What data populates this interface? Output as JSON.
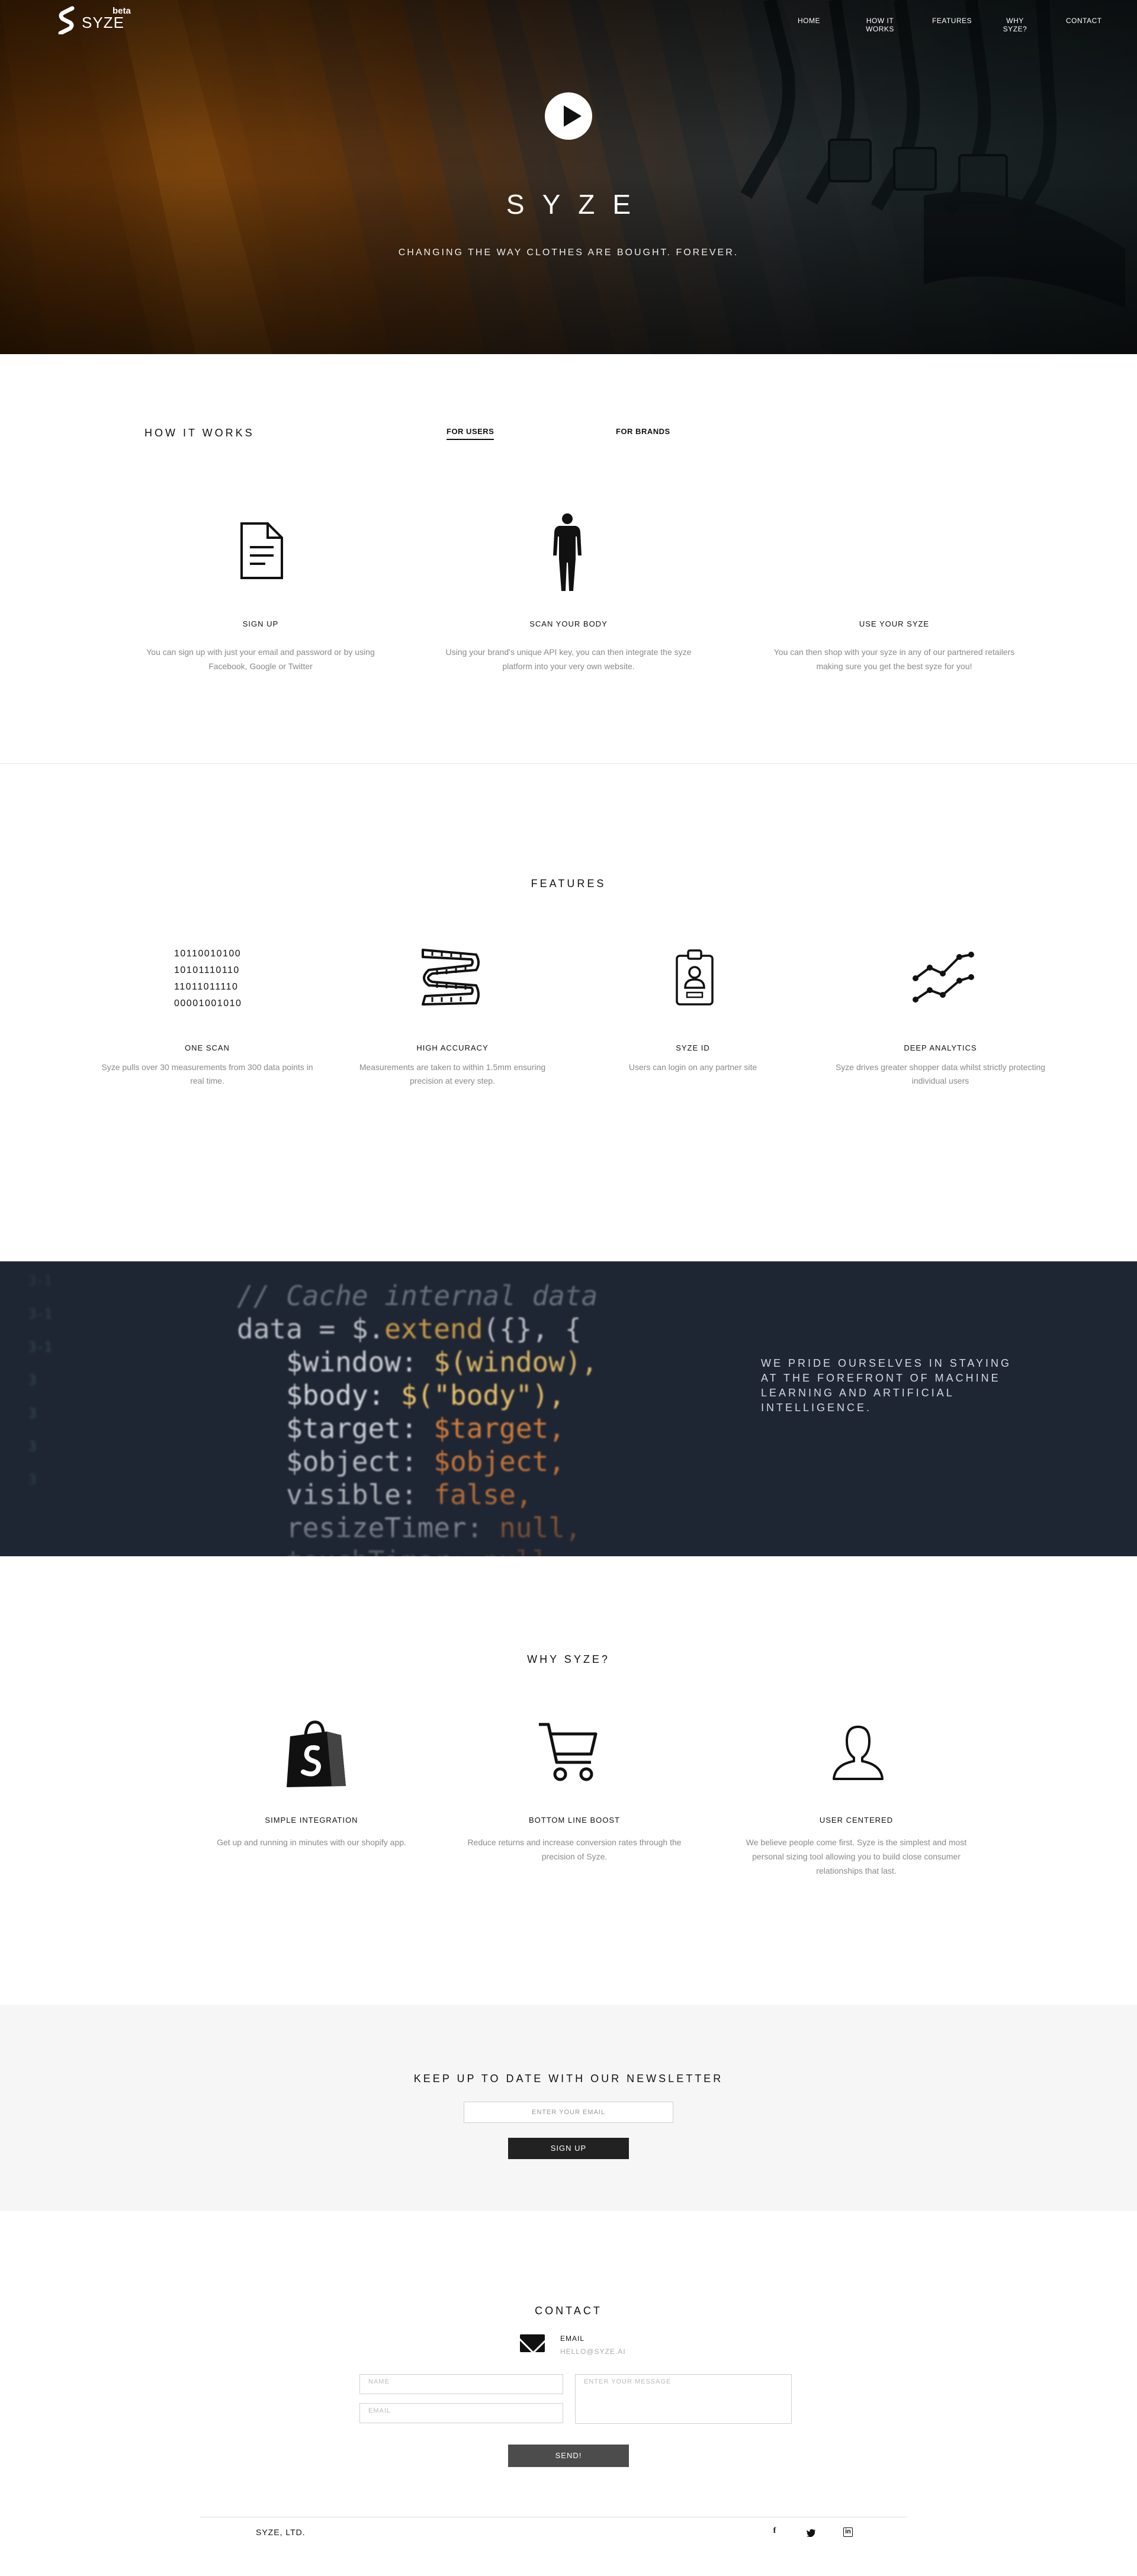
{
  "header": {
    "logo_text": "SYZE",
    "beta_label": "beta",
    "nav": [
      {
        "label": "HOME"
      },
      {
        "label": "HOW IT WORKS"
      },
      {
        "label": "FEATURES"
      },
      {
        "label": "WHY SYZE?"
      },
      {
        "label": "CONTACT"
      }
    ]
  },
  "hero": {
    "title": "SYZE",
    "subtitle": "CHANGING THE WAY CLOTHES ARE BOUGHT. FOREVER.",
    "play_icon": "play-icon",
    "background_colors": [
      "#8b4a0c",
      "#1a2224"
    ]
  },
  "how_it_works": {
    "heading": "HOW IT WORKS",
    "tabs": [
      {
        "label": "FOR USERS",
        "active": true
      },
      {
        "label": "FOR BRANDS",
        "active": false
      }
    ],
    "steps": [
      {
        "icon": "document-icon",
        "title": "SIGN UP",
        "text": "You can sign up with just your email and password or by using Facebook, Google or Twitter"
      },
      {
        "icon": "human-body-icon",
        "title": "SCAN YOUR BODY",
        "text": "Using your brand's unique API key, you can then integrate the syze platform into your very own website."
      },
      {
        "icon": null,
        "title": "USE YOUR SYZE",
        "text": "You can then shop with your syze in any of our partnered retailers making sure you get the best syze for you!"
      }
    ]
  },
  "features": {
    "heading": "FEATURES",
    "binary_lines": [
      "10110010100",
      "10101110110",
      "11011011110",
      "00001001010"
    ],
    "items": [
      {
        "icon": "binary-icon",
        "title": "ONE SCAN",
        "text": "Syze pulls over 30 measurements from 300 data points in real time."
      },
      {
        "icon": "measuring-tape-icon",
        "title": "HIGH ACCURACY",
        "text": "Measurements are taken to within 1.5mm ensuring precision at every step."
      },
      {
        "icon": "id-badge-icon",
        "title": "SYZE ID",
        "text": "Users can login on any partner site"
      },
      {
        "icon": "analytics-icon",
        "title": "DEEP ANALYTICS",
        "text": "Syze drives greater shopper data whilst strictly protecting individual users"
      }
    ]
  },
  "banner": {
    "text": "WE PRIDE OURSELVES IN STAYING AT THE FOREFRONT OF MACHINE LEARNING  AND ARTIFICIAL INTELLIGENCE.",
    "code_lines": [
      {
        "parts": [
          {
            "c": "cm",
            "t": "// Cache internal data"
          }
        ]
      },
      {
        "parts": [
          {
            "c": "kw",
            "t": "data = $."
          },
          {
            "c": "fn",
            "t": "extend"
          },
          {
            "c": "kw",
            "t": "({}, {"
          }
        ]
      },
      {
        "parts": [
          {
            "c": "kw",
            "t": "   $window: "
          },
          {
            "c": "st",
            "t": "$(window),"
          }
        ]
      },
      {
        "parts": [
          {
            "c": "kw",
            "t": "   $body: "
          },
          {
            "c": "st",
            "t": "$(\"body\"),"
          }
        ]
      },
      {
        "parts": [
          {
            "c": "kw",
            "t": "   $target: "
          },
          {
            "c": "or",
            "t": "$target,"
          }
        ]
      },
      {
        "parts": [
          {
            "c": "kw",
            "t": "   $object: "
          },
          {
            "c": "or",
            "t": "$object,"
          }
        ]
      },
      {
        "parts": [
          {
            "c": "kw",
            "t": "   visible: "
          },
          {
            "c": "or",
            "t": "false,"
          }
        ]
      },
      {
        "parts": [
          {
            "c": "kw",
            "t": "   resizeTimer: "
          },
          {
            "c": "or",
            "t": "null,"
          }
        ]
      },
      {
        "parts": [
          {
            "c": "kw",
            "t": "   touchTimer: "
          },
          {
            "c": "or",
            "t": "null,"
          }
        ]
      }
    ],
    "gutter": [
      "3-1",
      "3-1",
      "3-1",
      "3",
      "3",
      "3",
      "3"
    ]
  },
  "why_syze": {
    "heading": "WHY SYZE?",
    "items": [
      {
        "icon": "shopify-bag-icon",
        "title": "SIMPLE INTEGRATION",
        "text": "Get up and running in minutes with our shopify app."
      },
      {
        "icon": "shopping-cart-icon",
        "title": "BOTTOM LINE BOOST",
        "text": "Reduce returns and increase conversion rates through the precision of Syze."
      },
      {
        "icon": "user-icon",
        "title": "USER CENTERED",
        "text": "We believe people come first. Syze is the simplest and most personal sizing tool allowing you to build close consumer relationships that last."
      }
    ]
  },
  "newsletter": {
    "heading": "KEEP UP TO DATE WITH OUR NEWSLETTER",
    "email_placeholder": "ENTER YOUR EMAIL",
    "button_label": "SIGN UP"
  },
  "contact": {
    "heading": "CONTACT",
    "email_label": "EMAIL",
    "email_value": "HELLO@SYZE.AI",
    "name_placeholder": "NAME",
    "email_placeholder": "EMAIL",
    "message_placeholder": "ENTER YOUR MESSAGE",
    "send_label": "SEND!"
  },
  "footer": {
    "company": "SYZE, LTD.",
    "social": [
      {
        "icon": "facebook-icon",
        "glyph": "f"
      },
      {
        "icon": "twitter-icon",
        "glyph": "🐦"
      },
      {
        "icon": "linkedin-icon",
        "glyph": "in"
      }
    ]
  }
}
